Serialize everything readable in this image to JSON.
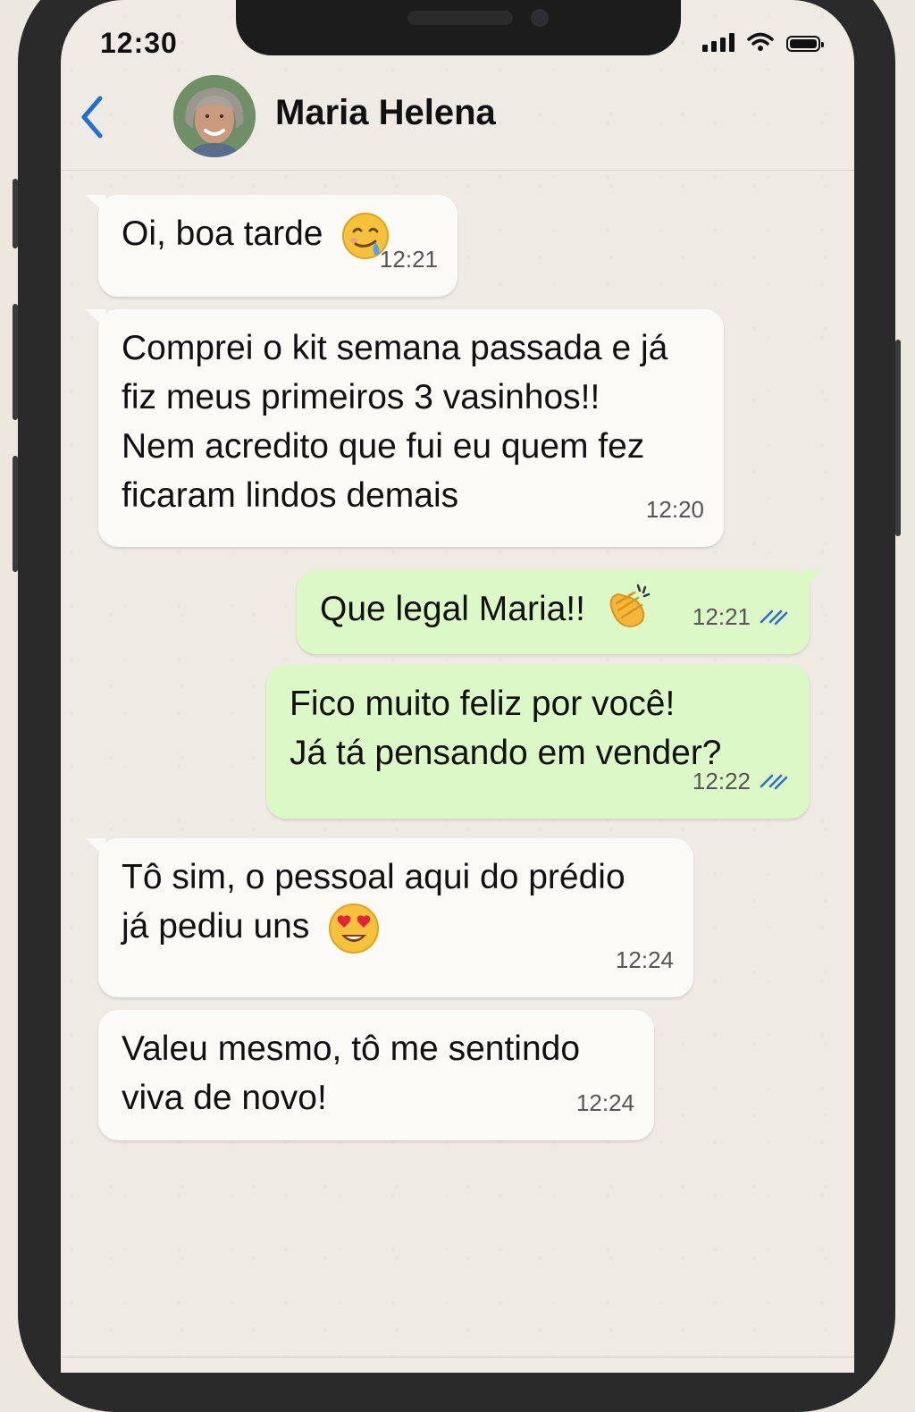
{
  "status_bar": {
    "time": "12:30"
  },
  "header": {
    "contact_name": "Maria Helena"
  },
  "colors": {
    "incoming_bubble": "#fbfaf7",
    "outgoing_bubble": "#dcf8c6",
    "accent": "#1f6fd1",
    "read_ticks": "#2d6cc9"
  },
  "messages": [
    {
      "direction": "in",
      "text": "Oi, boa tarde",
      "emoji": "drooling-face-icon",
      "time": "12:21"
    },
    {
      "direction": "in",
      "text": "Comprei o kit semana passada e já\nfiz meus primeiros 3 vasinhos!!\nNem acredito que fui eu quem fez\nficaram lindos demais",
      "time": "12:20"
    },
    {
      "direction": "out",
      "text": "Que legal Maria!!",
      "emoji": "clapping-hands-icon",
      "time": "12:21",
      "status": "read"
    },
    {
      "direction": "out",
      "text": "Fico muito feliz por você!\nJá tá pensando em vender?",
      "time": "12:22",
      "status": "read"
    },
    {
      "direction": "in",
      "text": "Tô sim, o pessoal aqui do prédio\njá pediu uns",
      "emoji": "heart-eyes-icon",
      "time": "12:24"
    },
    {
      "direction": "in",
      "text": "Valeu mesmo, tô me sentindo\nviva de novo!",
      "time": "12:24"
    }
  ]
}
